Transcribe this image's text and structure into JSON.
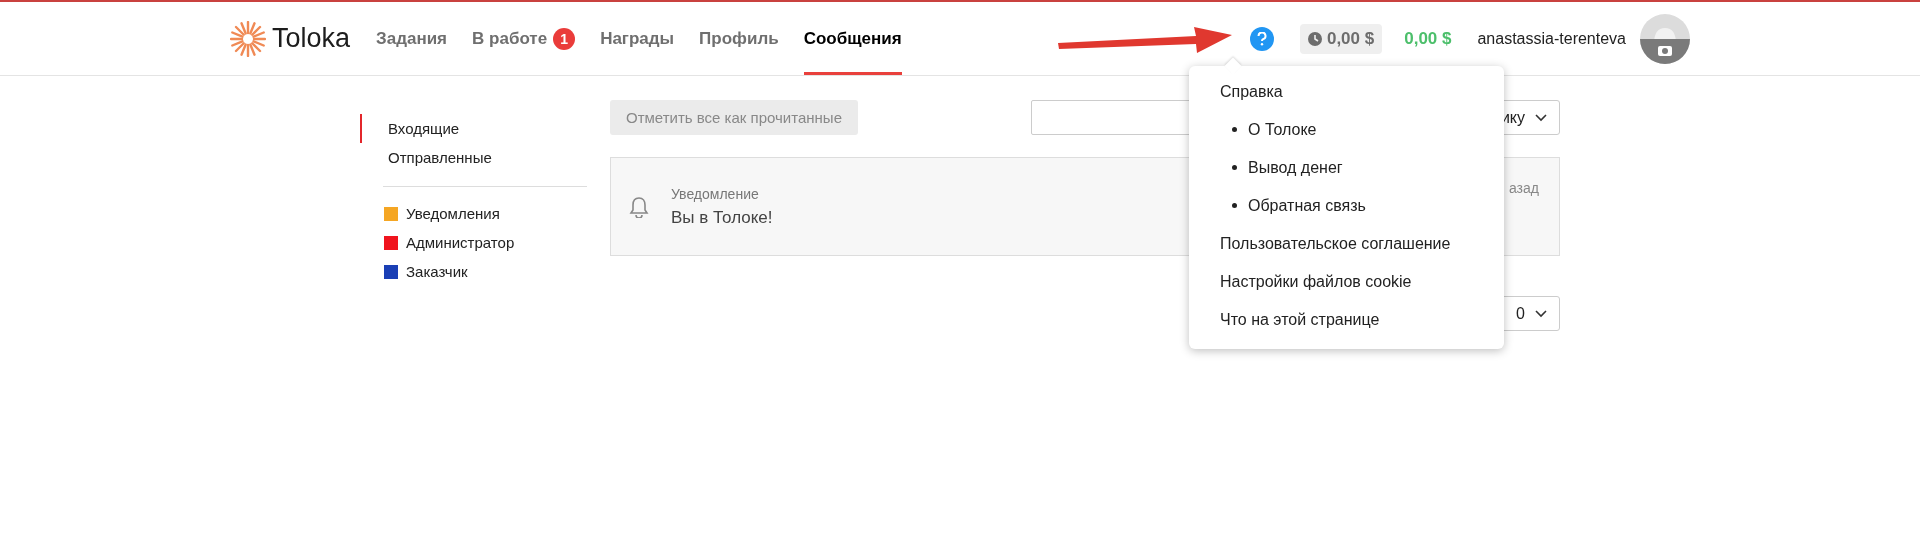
{
  "logo": {
    "text": "Toloka"
  },
  "nav": [
    {
      "label": "Задания",
      "selected": false
    },
    {
      "label": "В работе",
      "selected": false,
      "badge": "1"
    },
    {
      "label": "Награды",
      "selected": false
    },
    {
      "label": "Профиль",
      "selected": false
    },
    {
      "label": "Сообщения",
      "selected": true
    }
  ],
  "balance": {
    "pending": "0,00 $",
    "available": "0,00 $"
  },
  "user": {
    "name": "anastassia-terenteva"
  },
  "sidebar": {
    "folders": [
      {
        "label": "Входящие",
        "selected": true
      },
      {
        "label": "Отправленные",
        "selected": false
      }
    ],
    "categories": [
      {
        "label": "Уведомления",
        "color": "#f5a623"
      },
      {
        "label": "Администратор",
        "color": "#f0141e"
      },
      {
        "label": "Заказчик",
        "color": "#1a3fb5"
      }
    ]
  },
  "toolbar": {
    "mark_all_button": "Отметить все как прочитанные",
    "filter_select": "ику"
  },
  "messages": [
    {
      "category": "Уведомление",
      "title": "Вы в Толоке!",
      "time": "азад"
    }
  ],
  "pager": {
    "page_size_select": "0"
  },
  "help_menu": {
    "items": [
      {
        "label": "Справка",
        "kind": "link"
      },
      {
        "label": "О Толоке",
        "kind": "bullet"
      },
      {
        "label": "Вывод денег",
        "kind": "bullet"
      },
      {
        "label": "Обратная связь",
        "kind": "bullet"
      },
      {
        "label": "Пользовательское соглашение",
        "kind": "link"
      },
      {
        "label": "Настройки файлов cookie",
        "kind": "link"
      },
      {
        "label": "Что на этой странице",
        "kind": "link"
      }
    ]
  }
}
